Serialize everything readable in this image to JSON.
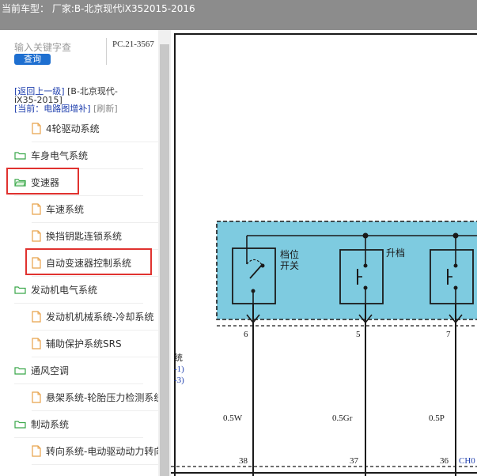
{
  "header": {
    "title": "当前车型：   厂家:B-北京现代iX352015-2016"
  },
  "sidebar": {
    "search": {
      "placeholder": "输入关键字查",
      "button_label": "查询"
    },
    "pc_code": "PC.21-3567",
    "breadcrumb": {
      "back_link": "[返回上一级]",
      "parent_line1": "[B-北京现代-",
      "parent_line2": "iX35-2015]",
      "current": "[当前：电路图增补]",
      "refresh": "[刷新]"
    },
    "tree": [
      {
        "label": "4轮驱动系统",
        "type": "file",
        "level": 2
      },
      {
        "label": "车身电气系统",
        "type": "folder",
        "level": 1
      },
      {
        "label": "变速器",
        "type": "folder-open",
        "level": 1,
        "highlighted": true
      },
      {
        "label": "车速系统",
        "type": "file",
        "level": 2
      },
      {
        "label": "换挡钥匙连锁系统",
        "type": "file",
        "level": 2
      },
      {
        "label": "自动变速器控制系统",
        "type": "file",
        "level": 2,
        "highlighted": true
      },
      {
        "label": "发动机电气系统",
        "type": "folder",
        "level": 1
      },
      {
        "label": "发动机机械系统-冷却系统",
        "type": "file",
        "level": 2
      },
      {
        "label": "辅助保护系统SRS",
        "type": "file",
        "level": 2
      },
      {
        "label": "通风空调",
        "type": "folder",
        "level": 1
      },
      {
        "label": "悬架系统-轮胎压力检测系统",
        "type": "file",
        "level": 2
      },
      {
        "label": "制动系统",
        "type": "folder",
        "level": 1
      },
      {
        "label": "转向系统-电动驱动动力转向",
        "type": "file",
        "level": 2
      }
    ]
  },
  "diagram": {
    "switch_box_label": [
      "档位",
      "开关"
    ],
    "upshift_label": "升档",
    "pins": [
      "6",
      "5",
      "7"
    ],
    "wires": [
      "0.5W",
      "0.5Gr",
      "0.5P"
    ],
    "connector_pins": [
      "38",
      "37",
      "36"
    ],
    "connector_label": "CH0",
    "left_text": [
      "统",
      "-1)",
      "-3)"
    ]
  },
  "colors": {
    "topbar": "#8c8c8c",
    "search_button": "#1e6fd0",
    "highlight": "#e0322f",
    "diagram_fill": "#7ecbe0",
    "link": "#1f3fae"
  }
}
